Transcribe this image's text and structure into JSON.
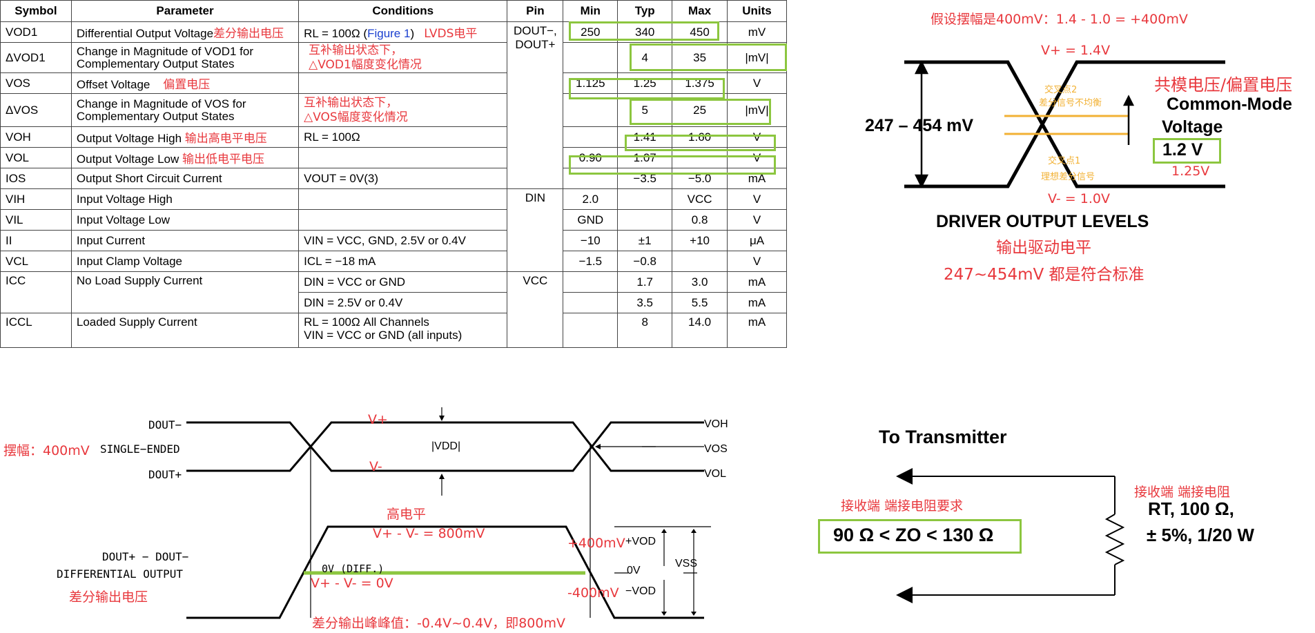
{
  "table": {
    "headers": [
      "Symbol",
      "Parameter",
      "Conditions",
      "Pin",
      "Min",
      "Typ",
      "Max",
      "Units"
    ],
    "rows": [
      {
        "symbol": "VOD1",
        "parameter": "Differential Output Voltage",
        "param_anno": "差分输出电压",
        "cond_pre": "RL = 100Ω (",
        "cond_link": "Figure 1",
        "cond_post": ")",
        "cond_anno": "LVDS电平",
        "pin": "DOUT−, DOUT+",
        "min": "250",
        "typ": "340",
        "max": "450",
        "units": "mV"
      },
      {
        "symbol": "ΔVOD1",
        "parameter": "Change in Magnitude of VOD1 for Complementary Output States",
        "cond_anno": "互补输出状态下，\n△VOD1幅度变化情况",
        "min": "",
        "typ": "4",
        "max": "35",
        "units": "|mV|"
      },
      {
        "symbol": "VOS",
        "parameter": "Offset Voltage",
        "param_anno": "偏置电压",
        "min": "1.125",
        "typ": "1.25",
        "max": "1.375",
        "units": "V"
      },
      {
        "symbol": "ΔVOS",
        "parameter": "Change in Magnitude of VOS for Complementary Output States",
        "cond_anno": "互补输出状态下，\n△VOS幅度变化情况",
        "min": "",
        "typ": "5",
        "max": "25",
        "units": "|mV|"
      },
      {
        "symbol": "VOH",
        "parameter": "Output Voltage High",
        "param_anno": "输出高电平电压",
        "cond": "RL = 100Ω",
        "min": "",
        "typ": "1.41",
        "max": "1.60",
        "units": "V"
      },
      {
        "symbol": "VOL",
        "parameter": "Output Voltage Low",
        "param_anno": "输出低电平电压",
        "min": "0.90",
        "typ": "1.07",
        "max": "",
        "units": "V"
      },
      {
        "symbol": "IOS",
        "parameter": "Output Short Circuit Current",
        "cond": "VOUT = 0V(3)",
        "min": "",
        "typ": "−3.5",
        "max": "−5.0",
        "units": "mA"
      },
      {
        "symbol": "VIH",
        "parameter": "Input Voltage High",
        "pin": "DIN",
        "min": "2.0",
        "typ": "",
        "max": "VCC",
        "units": "V"
      },
      {
        "symbol": "VIL",
        "parameter": "Input Voltage Low",
        "min": "GND",
        "typ": "",
        "max": "0.8",
        "units": "V"
      },
      {
        "symbol": "II",
        "parameter": "Input Current",
        "cond": "VIN = VCC, GND, 2.5V or 0.4V",
        "min": "−10",
        "typ": "±1",
        "max": "+10",
        "units": "μA"
      },
      {
        "symbol": "VCL",
        "parameter": "Input Clamp Voltage",
        "cond": "ICL = −18 mA",
        "min": "−1.5",
        "typ": "−0.8",
        "max": "",
        "units": "V"
      },
      {
        "symbol": "ICC",
        "parameter": "No Load Supply Current",
        "cond": "DIN = VCC or GND",
        "pin": "VCC",
        "min": "",
        "typ": "1.7",
        "max": "3.0",
        "units": "mA"
      },
      {
        "symbol": "",
        "parameter": "",
        "cond": "DIN = 2.5V or 0.4V",
        "min": "",
        "typ": "3.5",
        "max": "5.5",
        "units": "mA"
      },
      {
        "symbol": "ICCL",
        "parameter": "Loaded Supply Current",
        "cond": "RL = 100Ω All Channels\nVIN = VCC or GND (all inputs)",
        "min": "",
        "typ": "8",
        "max": "14.0",
        "units": "mA"
      }
    ]
  },
  "driver_levels": {
    "top_anno": "假设摆幅是400mV：1.4 - 1.0 = +400mV",
    "vplus": "V+ = 1.4V",
    "vminus": "V- = 1.0V",
    "range": "247 – 454 mV",
    "cross2": "交叉点2",
    "cross2_sub": "差分信号不均衡",
    "cross1": "交叉点1",
    "cross1_sub": "理想差分信号",
    "cm_anno": "共模电压/偏置电压",
    "cm_title1": "Common-Mode",
    "cm_title2": "Voltage",
    "cm_value": "1.2 V",
    "cm_anno2": "1.25V",
    "title": "DRIVER OUTPUT LEVELS",
    "title_anno1": "输出驱动电平",
    "title_anno2": "247~454mV 都是符合标准"
  },
  "waveform": {
    "dout_minus": "DOUT−",
    "dout_plus": "DOUT+",
    "single_ended": "SINGLE−ENDED",
    "swing_anno": "摆幅：400mV",
    "vplus": "V+",
    "vminus": "V-",
    "vdd": "|VDD|",
    "voh": "VOH",
    "vos": "VOS",
    "vol": "VOL",
    "diff_label1": "DOUT+ − DOUT−",
    "diff_label2": "DIFFERENTIAL OUTPUT",
    "diff_anno": "差分输出电压",
    "high_anno": "高电平",
    "high_eq": "V+ - V- = 800mV",
    "zero_eq": "V+ - V- = 0V",
    "zero_diff": "0V (DIFF.)",
    "plus400": "+400mV",
    "minus400": "-400mV",
    "vod_plus": "+VOD",
    "vod_minus": "−VOD",
    "zero": "0V",
    "vss": "VSS",
    "pp_anno": "差分输出峰峰值：-0.4V~0.4V，即800mV"
  },
  "termination": {
    "title": "To Transmitter",
    "req_anno": "接收端 端接电阻要求",
    "req": "90 Ω < ZO < 130 Ω",
    "rt_anno": "接收端 端接电阻",
    "rt1": "RT, 100 Ω,",
    "rt2": "± 5%, 1/20 W"
  },
  "colors": {
    "annotation": "#e8383d",
    "highlight": "#8cc63f",
    "crosshair": "#f2b134",
    "link": "#1a3fcf"
  }
}
